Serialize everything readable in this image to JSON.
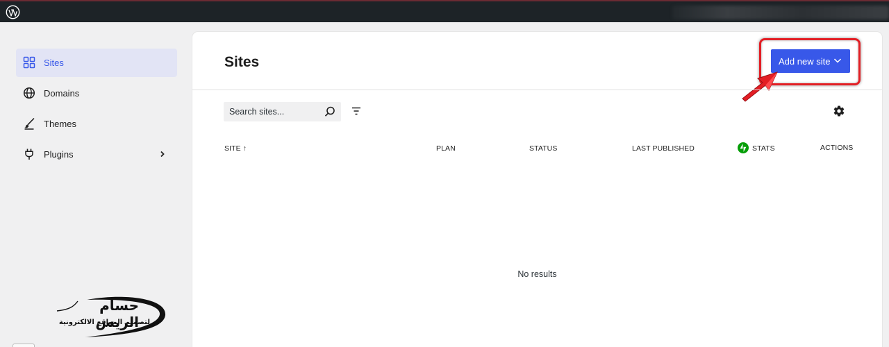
{
  "colors": {
    "accent": "#3858e9",
    "topbar": "#1d2327",
    "highlight": "#e31e24",
    "stats": "#069e08"
  },
  "topbar": {
    "logo_icon": "wordpress-icon"
  },
  "sidebar": {
    "items": [
      {
        "label": "Sites",
        "icon": "grid-icon",
        "active": true
      },
      {
        "label": "Domains",
        "icon": "globe-icon"
      },
      {
        "label": "Themes",
        "icon": "brush-icon"
      },
      {
        "label": "Plugins",
        "icon": "plug-icon",
        "has_submenu": true
      }
    ]
  },
  "brand": {
    "title": "حسام الريس",
    "subtitle": "لتصميم المواقع الالكترونية"
  },
  "main": {
    "title": "Sites",
    "add_button": {
      "label": "Add new site",
      "icon": "chevron-down-icon"
    },
    "search": {
      "placeholder": "Search sites...",
      "icon": "search-icon"
    },
    "filter_icon": "filter-icon",
    "settings_icon": "gear-icon",
    "table": {
      "columns": [
        {
          "label": "SITE ↑",
          "sortable": true
        },
        {
          "label": "PLAN"
        },
        {
          "label": "STATUS"
        },
        {
          "label": "LAST PUBLISHED"
        },
        {
          "label": "STATS",
          "icon": "jetpack-icon"
        },
        {
          "label": "ACTIONS"
        }
      ],
      "empty_text": "No results"
    }
  }
}
